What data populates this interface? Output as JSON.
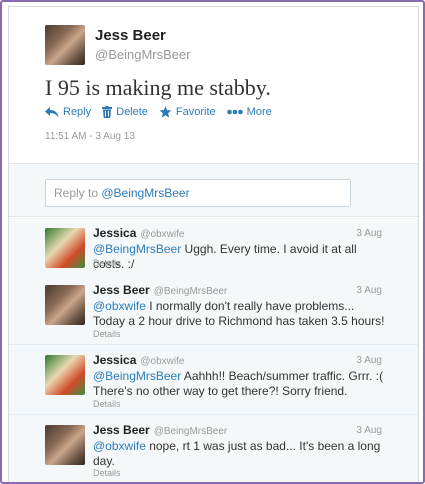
{
  "main_tweet": {
    "name": "Jess Beer",
    "handle": "@BeingMrsBeer",
    "text": "I 95 is making me stabby.",
    "actions": {
      "reply": "Reply",
      "delete": "Delete",
      "favorite": "Favorite",
      "more": "More"
    },
    "timestamp": "11:51 AM - 3 Aug 13"
  },
  "reply_box": {
    "prefix": "Reply to ",
    "mention": "@BeingMrsBeer"
  },
  "replies": [
    {
      "name": "Jessica",
      "handle": "@obxwife",
      "date": "3 Aug",
      "mention": "@BeingMrsBeer",
      "text": " Uggh. Every time. I avoid it at all costs. :/",
      "details": "Details"
    },
    {
      "name": "Jess Beer",
      "handle": "@BeingMrsBeer",
      "date": "3 Aug",
      "mention": "@obxwife",
      "text": " I normally don't really have problems... Today a 2 hour drive to Richmond has taken 3.5 hours!",
      "details": "Details"
    },
    {
      "name": "Jessica",
      "handle": "@obxwife",
      "date": "3 Aug",
      "mention": "@BeingMrsBeer",
      "text": " Aahhh!! Beach/summer traffic. Grrr. :( There's no other way to get there?! Sorry friend.",
      "details": "Details"
    },
    {
      "name": "Jess Beer",
      "handle": "@BeingMrsBeer",
      "date": "3 Aug",
      "mention": "@obxwife",
      "text": " nope, rt 1 was just as bad... It's been a long day.",
      "details": "Details"
    }
  ],
  "colors": {
    "link": "#2b7bb9",
    "frame": "#8b6ab0"
  }
}
